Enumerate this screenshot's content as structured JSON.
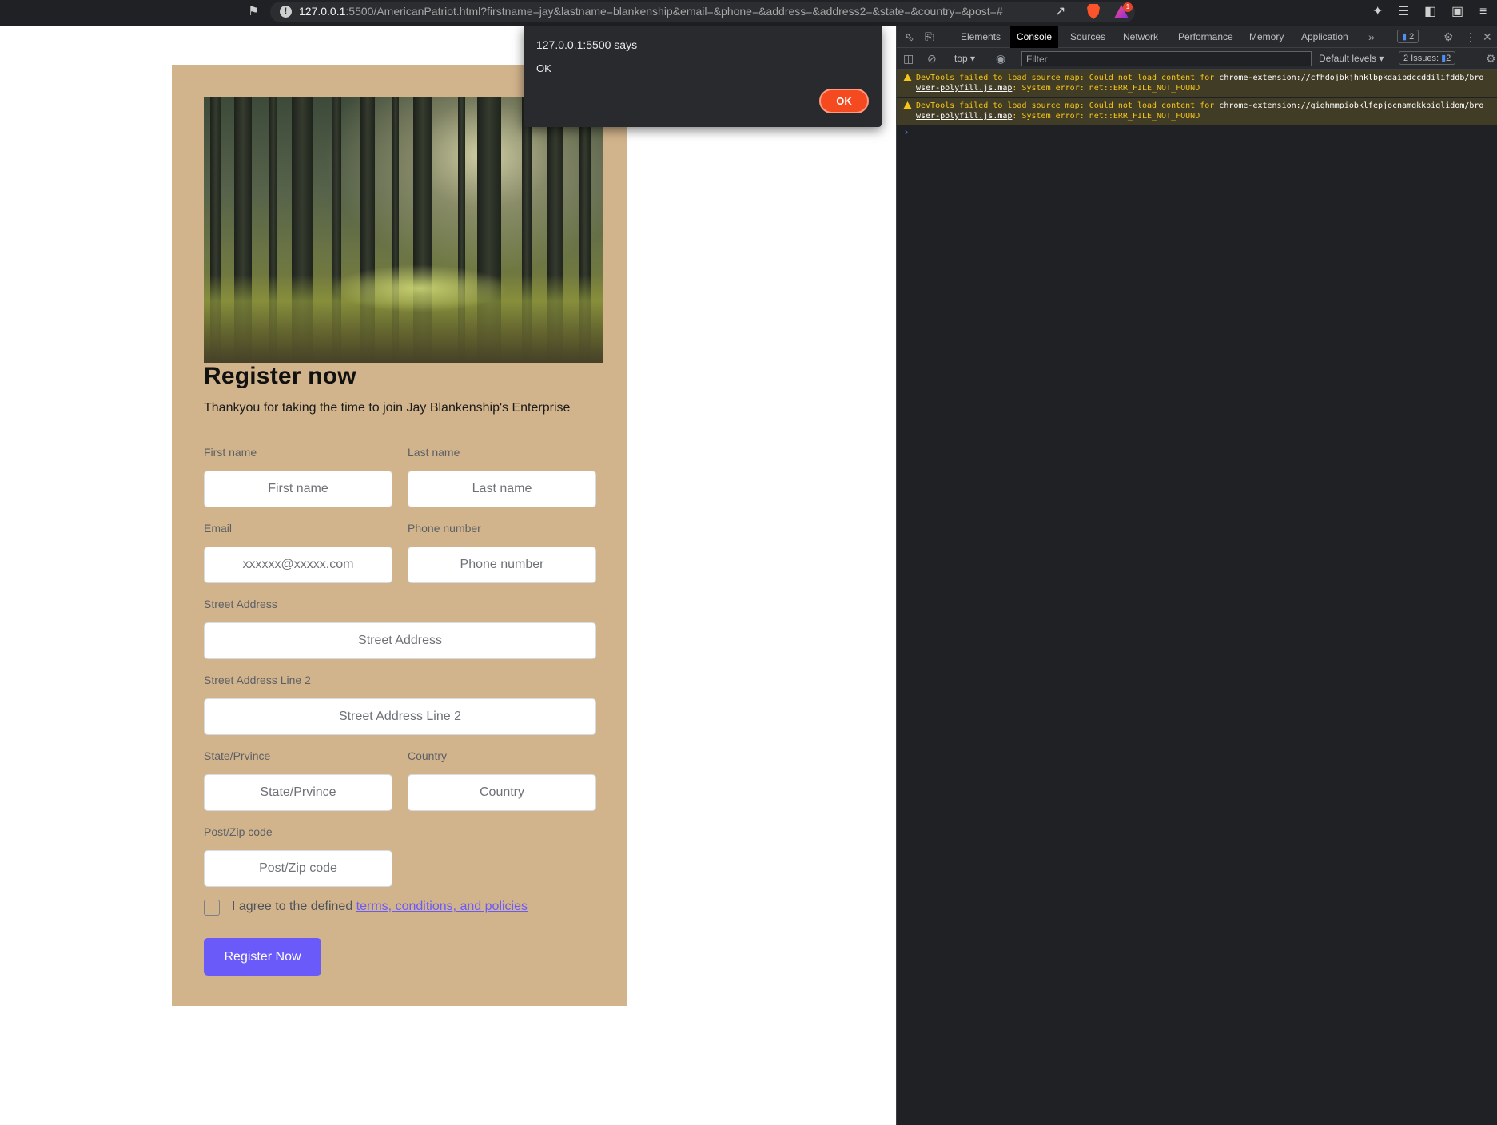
{
  "browser": {
    "url_host": "127.0.0.1",
    "url_rest": ":5500/AmericanPatriot.html?firstname=jay&lastname=blankenship&email=&phone=&address=&address2=&state=&country=&post=#",
    "rewards_badge": "1",
    "icons": [
      "bookmark-icon",
      "info-icon",
      "share-icon",
      "brave-shield-icon",
      "brave-rewards-icon",
      "extensions-icon",
      "media-queue-icon",
      "sidebar-icon",
      "wallet-icon",
      "menu-icon"
    ]
  },
  "form": {
    "title": "Register now",
    "subtitle": "Thankyou for taking the time to join Jay Blankenship's Enterprise",
    "first_name": {
      "label": "First name",
      "placeholder": "First name"
    },
    "last_name": {
      "label": "Last name",
      "placeholder": "Last name"
    },
    "email": {
      "label": "Email",
      "placeholder": "xxxxxx@xxxxx.com"
    },
    "phone": {
      "label": "Phone number",
      "placeholder": "Phone number"
    },
    "address": {
      "label": "Street Address",
      "placeholder": "Street Address"
    },
    "address2": {
      "label": "Street Address Line 2",
      "placeholder": "Street Address Line 2"
    },
    "state": {
      "label": "State/Prvince",
      "placeholder": "State/Prvince"
    },
    "country": {
      "label": "Country",
      "placeholder": "Country"
    },
    "post": {
      "label": "Post/Zip code",
      "placeholder": "Post/Zip code"
    },
    "agree_prefix": "I agree to the defined ",
    "agree_link": "terms, conditions, and policies",
    "submit_label": "Register Now",
    "colors": {
      "card_bg": "#d2b48c",
      "accent": "#6a5af9"
    }
  },
  "dialog": {
    "title": "127.0.0.1:5500 says",
    "message": "OK",
    "ok_label": "OK"
  },
  "devtools": {
    "tabs": [
      "Elements",
      "Console",
      "Sources",
      "Network",
      "Performance",
      "Memory",
      "Application"
    ],
    "active_tab": "Console",
    "messages_badge": "2",
    "context": "top",
    "filter_placeholder": "Filter",
    "levels": "Default levels",
    "issues_label": "2 Issues:",
    "issues_count": "2",
    "warnings": [
      {
        "prefix": "DevTools failed to load source map: Could not load content for ",
        "link": "chrome-extension://cfhdojbkjhnklbpkdaibdccddilifddb/browser-polyfill.js.map",
        "suffix": ": System error: net::ERR_FILE_NOT_FOUND"
      },
      {
        "prefix": "DevTools failed to load source map: Could not load content for ",
        "link": "chrome-extension://gighmmpiobklfepjocnamgkkbiglidom/browser-polyfill.js.map",
        "suffix": ": System error: net::ERR_FILE_NOT_FOUND"
      }
    ],
    "prompt": "›"
  }
}
